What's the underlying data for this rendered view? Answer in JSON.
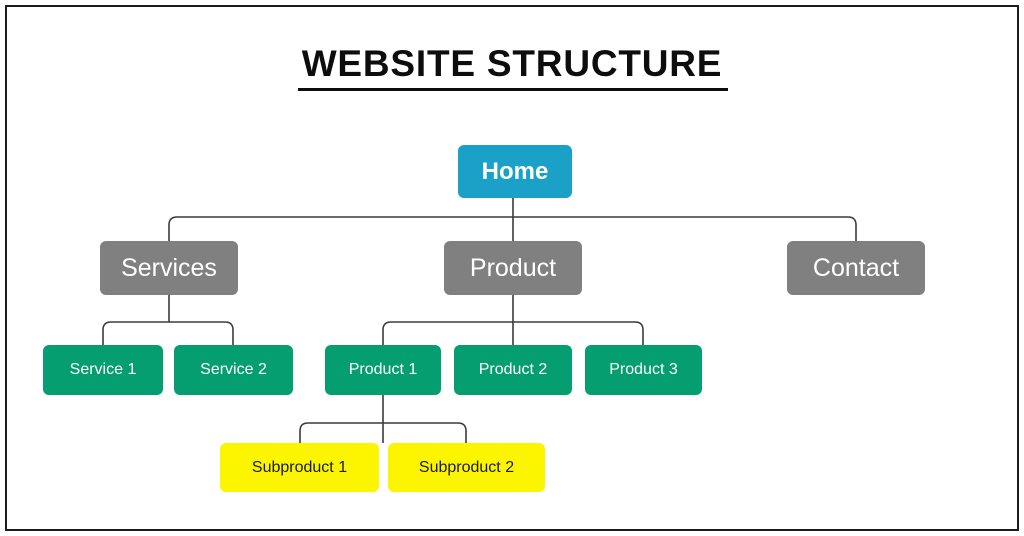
{
  "document": {
    "title": "WEBSITE STRUCTURE"
  },
  "colors": {
    "home": "#1BA0C8",
    "section": "#808080",
    "leaf_green": "#059E70",
    "leaf_yellow": "#FCF500",
    "connector": "#3B3B3B",
    "title": "#0D0D0D",
    "frame": "#1C1C1C",
    "background": "#FFFFFF"
  },
  "chart_data": {
    "type": "diagram",
    "title": "WEBSITE STRUCTURE",
    "nodes": [
      {
        "id": "home",
        "label": "Home",
        "level": 0,
        "color": "#1BA0C8",
        "text_color": "#FFFFFF",
        "parent": null
      },
      {
        "id": "services",
        "label": "Services",
        "level": 1,
        "color": "#808080",
        "text_color": "#FFFFFF",
        "parent": "home"
      },
      {
        "id": "product",
        "label": "Product",
        "level": 1,
        "color": "#808080",
        "text_color": "#FFFFFF",
        "parent": "home"
      },
      {
        "id": "contact",
        "label": "Contact",
        "level": 1,
        "color": "#808080",
        "text_color": "#FFFFFF",
        "parent": "home"
      },
      {
        "id": "service1",
        "label": "Service 1",
        "level": 2,
        "color": "#059E70",
        "text_color": "#FFFFFF",
        "parent": "services"
      },
      {
        "id": "service2",
        "label": "Service 2",
        "level": 2,
        "color": "#059E70",
        "text_color": "#FFFFFF",
        "parent": "services"
      },
      {
        "id": "product1",
        "label": "Product 1",
        "level": 2,
        "color": "#059E70",
        "text_color": "#FFFFFF",
        "parent": "product"
      },
      {
        "id": "product2",
        "label": "Product 2",
        "level": 2,
        "color": "#059E70",
        "text_color": "#FFFFFF",
        "parent": "product"
      },
      {
        "id": "product3",
        "label": "Product 3",
        "level": 2,
        "color": "#059E70",
        "text_color": "#FFFFFF",
        "parent": "product"
      },
      {
        "id": "subproduct1",
        "label": "Subproduct 1",
        "level": 3,
        "color": "#FCF500",
        "text_color": "#1A1A1A",
        "parent": "product1"
      },
      {
        "id": "subproduct2",
        "label": "Subproduct 2",
        "level": 3,
        "color": "#FCF500",
        "text_color": "#1A1A1A",
        "parent": "product1"
      }
    ],
    "edges": [
      {
        "from": "home",
        "to": "services"
      },
      {
        "from": "home",
        "to": "product"
      },
      {
        "from": "home",
        "to": "contact"
      },
      {
        "from": "services",
        "to": "service1"
      },
      {
        "from": "services",
        "to": "service2"
      },
      {
        "from": "product",
        "to": "product1"
      },
      {
        "from": "product",
        "to": "product2"
      },
      {
        "from": "product",
        "to": "product3"
      },
      {
        "from": "product1",
        "to": "subproduct1"
      },
      {
        "from": "product1",
        "to": "subproduct2"
      }
    ]
  },
  "nodes": {
    "home": {
      "label": "Home"
    },
    "services": {
      "label": "Services"
    },
    "product": {
      "label": "Product"
    },
    "contact": {
      "label": "Contact"
    },
    "service1": {
      "label": "Service 1"
    },
    "service2": {
      "label": "Service 2"
    },
    "product1": {
      "label": "Product 1"
    },
    "product2": {
      "label": "Product 2"
    },
    "product3": {
      "label": "Product 3"
    },
    "subproduct1": {
      "label": "Subproduct 1"
    },
    "subproduct2": {
      "label": "Subproduct 2"
    }
  }
}
